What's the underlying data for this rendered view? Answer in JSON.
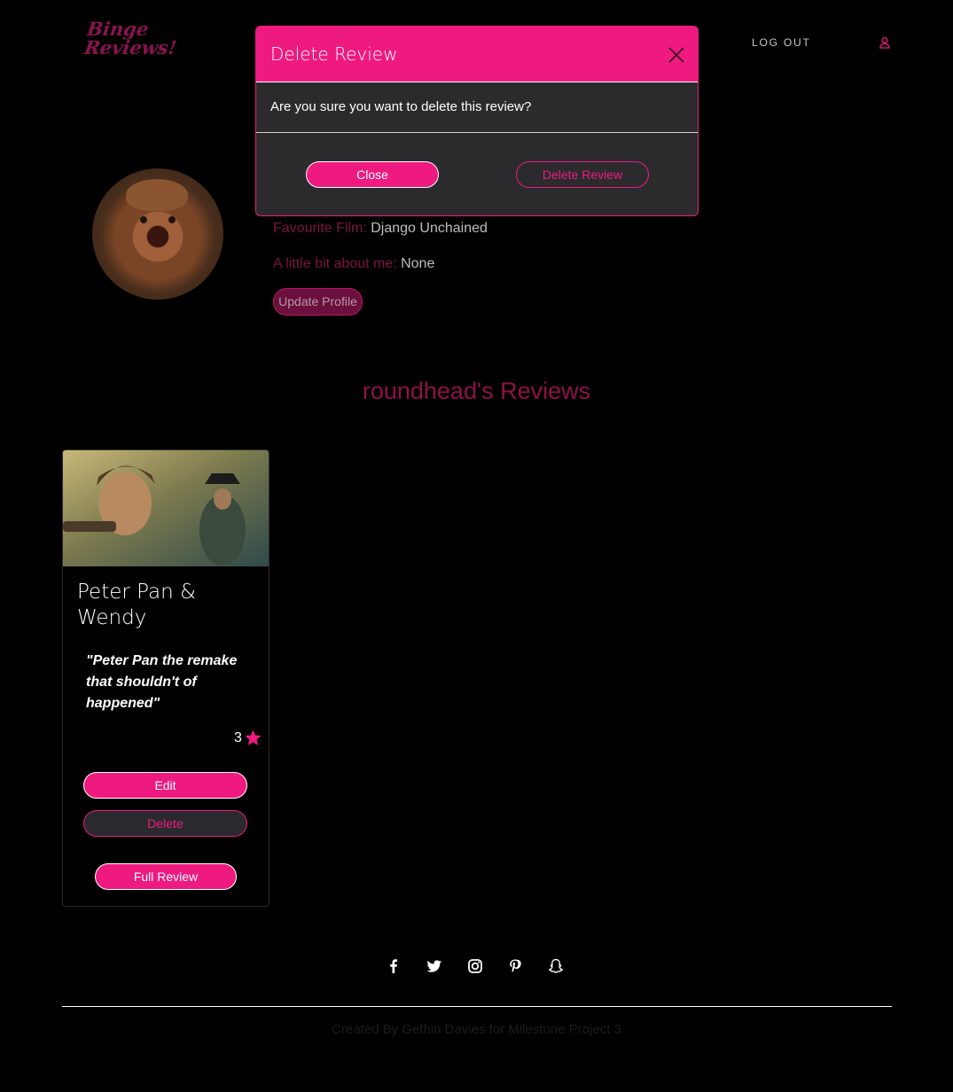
{
  "colors": {
    "accent": "#ef1a80",
    "dimmed_accent": "#8d1248",
    "background": "#000000",
    "panel": "#2b2b2e"
  },
  "header": {
    "logo_line1": "Binge",
    "logo_line2": "Reviews!",
    "logout_label": "LOG OUT",
    "user_icon": "user-icon"
  },
  "profile": {
    "favourite_film_label": "Favourite Film:",
    "favourite_film_value": "Django Unchained",
    "about_label": "A little bit about me:",
    "about_value": "None",
    "update_button": "Update Profile"
  },
  "reviews_heading": "roundhead's Reviews",
  "reviews": [
    {
      "title": "Peter Pan & Wendy",
      "quote": "\"Peter Pan the remake that shouldn't of happened\"",
      "rating": "3",
      "rating_icon": "star-icon",
      "edit_label": "Edit",
      "delete_label": "Delete",
      "full_review_label": "Full Review"
    }
  ],
  "footer": {
    "social_icons": [
      "facebook-icon",
      "twitter-icon",
      "instagram-icon",
      "pinterest-icon",
      "snapchat-icon"
    ],
    "credit": "Created By Gethin Davies for Milestone Project 3"
  },
  "modal": {
    "title": "Delete Review",
    "message": "Are you sure you want to delete this review?",
    "close_label": "Close",
    "confirm_label": "Delete Review",
    "close_icon": "close-icon"
  }
}
